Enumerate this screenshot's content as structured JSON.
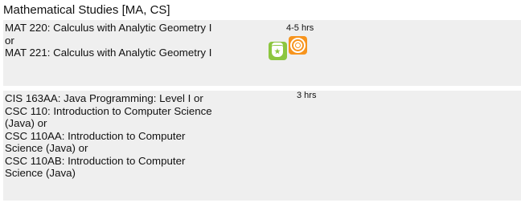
{
  "section": {
    "title": "Mathematical Studies [MA, CS]"
  },
  "requirements": [
    {
      "courses": [
        "MAT 220: Calculus with Analytic Geometry I",
        "or",
        "MAT 221: Calculus with Analytic Geometry I"
      ],
      "hours": "4-5 hrs",
      "icons": [
        "green-star-bag-icon",
        "orange-target-icon"
      ],
      "colors": {
        "green_icon": "#8cc63f",
        "orange_icon": "#f7941d"
      }
    },
    {
      "courses": [
        "CIS 163AA: Java Programming: Level I or",
        "CSC 110: Introduction to Computer Science",
        "(Java) or",
        "CSC 110AA: Introduction to Computer",
        "Science (Java) or",
        "CSC 110AB: Introduction to Computer",
        "Science (Java)"
      ],
      "hours": "3 hrs",
      "icons": []
    }
  ],
  "colors": {
    "row_background": "#efefef",
    "text": "#111111"
  }
}
